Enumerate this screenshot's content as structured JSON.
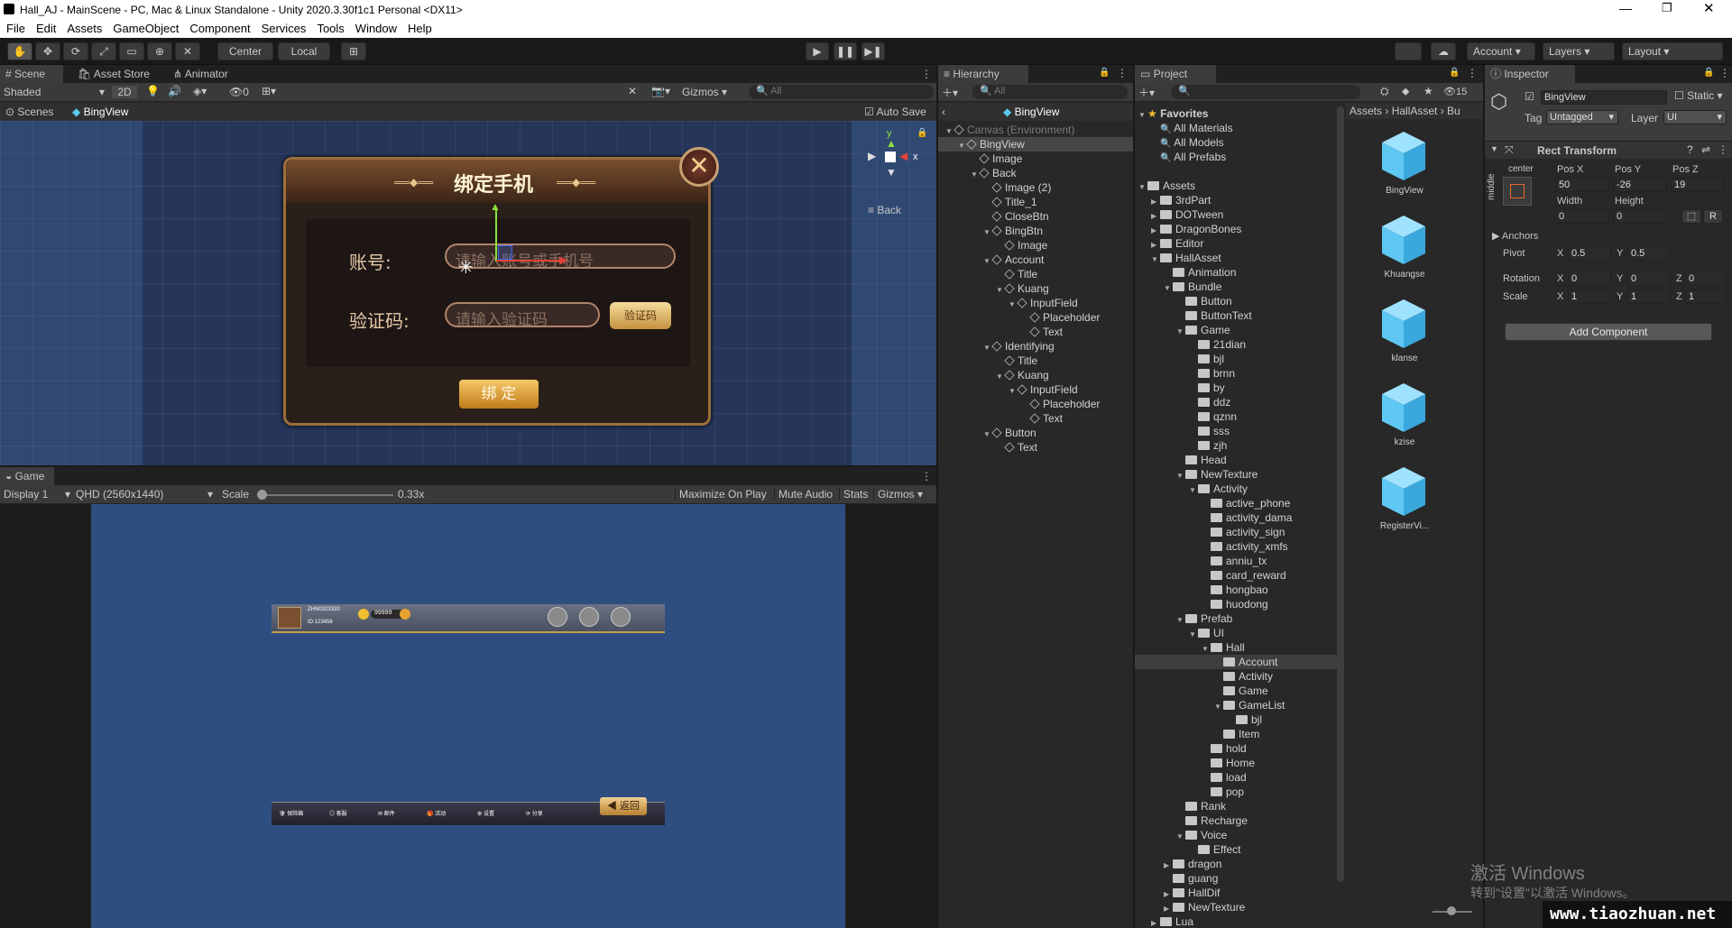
{
  "window": {
    "title": "Hall_AJ - MainScene - PC, Mac & Linux Standalone - Unity 2020.3.30f1c1 Personal <DX11>"
  },
  "menu": [
    "File",
    "Edit",
    "Assets",
    "GameObject",
    "Component",
    "Services",
    "Tools",
    "Window",
    "Help"
  ],
  "toolbar": {
    "center": "Center",
    "local": "Local",
    "account": "Account",
    "layers": "Layers",
    "layout": "Layout"
  },
  "scene": {
    "tabs": [
      "Scene",
      "Asset Store",
      "Animator"
    ],
    "shading": "Shaded",
    "mode2d": "2D",
    "hidden_count": "0",
    "gizmos": "Gizmos",
    "search_placeholder": "All",
    "breadcrumb_scenes": "Scenes",
    "breadcrumb_object": "BingView",
    "autosave": "Auto Save",
    "gizmo_y": "y",
    "gizmo_x": "x",
    "back_label": "Back",
    "dialog": {
      "title": "绑定手机",
      "account_label": "账号:",
      "account_placeholder": "请输入账号或手机号",
      "code_label": "验证码:",
      "code_placeholder": "请输入验证码",
      "code_button": "验证码",
      "bind_button": "绑 定"
    }
  },
  "game": {
    "tab": "Game",
    "display": "Display 1",
    "resolution": "QHD (2560x1440)",
    "scale_label": "Scale",
    "scale_value": "0.33x",
    "scale_fraction": 0.0,
    "buttons": [
      "Maximize On Play",
      "Mute Audio",
      "Stats",
      "Gizmos"
    ],
    "topbar": {
      "name": "ZHN0323333",
      "id": "ID:123456",
      "coins": "99999"
    },
    "bottombar": {
      "items": [
        "保险箱",
        "客服",
        "邮件",
        "活动",
        "设置",
        "分享"
      ],
      "back": "返回"
    }
  },
  "hierarchy": {
    "tab": "Hierarchy",
    "search_placeholder": "All",
    "header": "BingView",
    "rows": [
      {
        "label": "Canvas (Environment)",
        "depth": 0,
        "arrow": "▼",
        "dim": true
      },
      {
        "label": "BingView",
        "depth": 1,
        "arrow": "▼",
        "selected": true
      },
      {
        "label": "Image",
        "depth": 2,
        "arrow": ""
      },
      {
        "label": "Back",
        "depth": 2,
        "arrow": "▼"
      },
      {
        "label": "Image (2)",
        "depth": 3,
        "arrow": ""
      },
      {
        "label": "Title_1",
        "depth": 3,
        "arrow": ""
      },
      {
        "label": "CloseBtn",
        "depth": 3,
        "arrow": ""
      },
      {
        "label": "BingBtn",
        "depth": 3,
        "arrow": "▼"
      },
      {
        "label": "Image",
        "depth": 4,
        "arrow": ""
      },
      {
        "label": "Account",
        "depth": 3,
        "arrow": "▼"
      },
      {
        "label": "Title",
        "depth": 4,
        "arrow": ""
      },
      {
        "label": "Kuang",
        "depth": 4,
        "arrow": "▼"
      },
      {
        "label": "InputField",
        "depth": 5,
        "arrow": "▼"
      },
      {
        "label": "Placeholder",
        "depth": 6,
        "arrow": ""
      },
      {
        "label": "Text",
        "depth": 6,
        "arrow": ""
      },
      {
        "label": "Identifying",
        "depth": 3,
        "arrow": "▼"
      },
      {
        "label": "Title",
        "depth": 4,
        "arrow": ""
      },
      {
        "label": "Kuang",
        "depth": 4,
        "arrow": "▼"
      },
      {
        "label": "InputField",
        "depth": 5,
        "arrow": "▼"
      },
      {
        "label": "Placeholder",
        "depth": 6,
        "arrow": ""
      },
      {
        "label": "Text",
        "depth": 6,
        "arrow": ""
      },
      {
        "label": "Button",
        "depth": 3,
        "arrow": "▼"
      },
      {
        "label": "Text",
        "depth": 4,
        "arrow": ""
      }
    ]
  },
  "project": {
    "tab": "Project",
    "hidden_count": "15",
    "breadcrumb": [
      "Assets",
      "HallAsset",
      "Bu"
    ],
    "rows": [
      {
        "label": "Favorites",
        "depth": 0,
        "arrow": "▼",
        "type": "star"
      },
      {
        "label": "All Materials",
        "depth": 1,
        "arrow": "",
        "type": "search"
      },
      {
        "label": "All Models",
        "depth": 1,
        "arrow": "",
        "type": "search"
      },
      {
        "label": "All Prefabs",
        "depth": 1,
        "arrow": "",
        "type": "search"
      },
      {
        "label": "",
        "depth": 0,
        "arrow": "",
        "type": "blank"
      },
      {
        "label": "Assets",
        "depth": 0,
        "arrow": "▼",
        "type": "folder"
      },
      {
        "label": "3rdPart",
        "depth": 1,
        "arrow": "▶",
        "type": "folder"
      },
      {
        "label": "DOTween",
        "depth": 1,
        "arrow": "▶",
        "type": "folder"
      },
      {
        "label": "DragonBones",
        "depth": 1,
        "arrow": "▶",
        "type": "folder"
      },
      {
        "label": "Editor",
        "depth": 1,
        "arrow": "▶",
        "type": "folder"
      },
      {
        "label": "HallAsset",
        "depth": 1,
        "arrow": "▼",
        "type": "folder"
      },
      {
        "label": "Animation",
        "depth": 2,
        "arrow": "",
        "type": "folder"
      },
      {
        "label": "Bundle",
        "depth": 2,
        "arrow": "▼",
        "type": "folder"
      },
      {
        "label": "Button",
        "depth": 3,
        "arrow": "",
        "type": "folder"
      },
      {
        "label": "ButtonText",
        "depth": 3,
        "arrow": "",
        "type": "folder"
      },
      {
        "label": "Game",
        "depth": 3,
        "arrow": "▼",
        "type": "folder"
      },
      {
        "label": "21dian",
        "depth": 4,
        "arrow": "",
        "type": "folder"
      },
      {
        "label": "bjl",
        "depth": 4,
        "arrow": "",
        "type": "folder"
      },
      {
        "label": "brnn",
        "depth": 4,
        "arrow": "",
        "type": "folder"
      },
      {
        "label": "by",
        "depth": 4,
        "arrow": "",
        "type": "folder"
      },
      {
        "label": "ddz",
        "depth": 4,
        "arrow": "",
        "type": "folder"
      },
      {
        "label": "qznn",
        "depth": 4,
        "arrow": "",
        "type": "folder"
      },
      {
        "label": "sss",
        "depth": 4,
        "arrow": "",
        "type": "folder"
      },
      {
        "label": "zjh",
        "depth": 4,
        "arrow": "",
        "type": "folder"
      },
      {
        "label": "Head",
        "depth": 3,
        "arrow": "",
        "type": "folder"
      },
      {
        "label": "NewTexture",
        "depth": 3,
        "arrow": "▼",
        "type": "folder"
      },
      {
        "label": "Activity",
        "depth": 4,
        "arrow": "▼",
        "type": "folder"
      },
      {
        "label": "active_phone",
        "depth": 5,
        "arrow": "",
        "type": "folder"
      },
      {
        "label": "activity_dama",
        "depth": 5,
        "arrow": "",
        "type": "folder"
      },
      {
        "label": "activity_sign",
        "depth": 5,
        "arrow": "",
        "type": "folder"
      },
      {
        "label": "activity_xmfs",
        "depth": 5,
        "arrow": "",
        "type": "folder"
      },
      {
        "label": "anniu_tx",
        "depth": 5,
        "arrow": "",
        "type": "folder"
      },
      {
        "label": "card_reward",
        "depth": 5,
        "arrow": "",
        "type": "folder"
      },
      {
        "label": "hongbao",
        "depth": 5,
        "arrow": "",
        "type": "folder"
      },
      {
        "label": "huodong",
        "depth": 5,
        "arrow": "",
        "type": "folder"
      },
      {
        "label": "Prefab",
        "depth": 3,
        "arrow": "▼",
        "type": "folder"
      },
      {
        "label": "UI",
        "depth": 4,
        "arrow": "▼",
        "type": "folder"
      },
      {
        "label": "Hall",
        "depth": 5,
        "arrow": "▼",
        "type": "folder"
      },
      {
        "label": "Account",
        "depth": 6,
        "arrow": "",
        "type": "folder",
        "selected": true
      },
      {
        "label": "Activity",
        "depth": 6,
        "arrow": "",
        "type": "folder"
      },
      {
        "label": "Game",
        "depth": 6,
        "arrow": "",
        "type": "folder"
      },
      {
        "label": "GameList",
        "depth": 6,
        "arrow": "▼",
        "type": "folder"
      },
      {
        "label": "bjl",
        "depth": 7,
        "arrow": "",
        "type": "folder"
      },
      {
        "label": "Item",
        "depth": 6,
        "arrow": "",
        "type": "folder"
      },
      {
        "label": "hold",
        "depth": 5,
        "arrow": "",
        "type": "folder"
      },
      {
        "label": "Home",
        "depth": 5,
        "arrow": "",
        "type": "folder"
      },
      {
        "label": "load",
        "depth": 5,
        "arrow": "",
        "type": "folder"
      },
      {
        "label": "pop",
        "depth": 5,
        "arrow": "",
        "type": "folder"
      },
      {
        "label": "Rank",
        "depth": 3,
        "arrow": "",
        "type": "folder"
      },
      {
        "label": "Recharge",
        "depth": 3,
        "arrow": "",
        "type": "folder"
      },
      {
        "label": "Voice",
        "depth": 3,
        "arrow": "▼",
        "type": "folder"
      },
      {
        "label": "Effect",
        "depth": 4,
        "arrow": "",
        "type": "folder"
      },
      {
        "label": "dragon",
        "depth": 2,
        "arrow": "▶",
        "type": "folder"
      },
      {
        "label": "guang",
        "depth": 2,
        "arrow": "",
        "type": "folder"
      },
      {
        "label": "HallDif",
        "depth": 2,
        "arrow": "▶",
        "type": "folder"
      },
      {
        "label": "NewTexture",
        "depth": 2,
        "arrow": "▶",
        "type": "folder"
      },
      {
        "label": "Lua",
        "depth": 1,
        "arrow": "▶",
        "type": "folder"
      }
    ],
    "assets": [
      "BingView",
      "Khuangse",
      "klanse",
      "kzise",
      "RegisterVi..."
    ]
  },
  "inspector": {
    "tab": "Inspector",
    "object_name": "BingView",
    "static_label": "Static",
    "tag_label": "Tag",
    "tag_value": "Untagged",
    "layer_label": "Layer",
    "layer_value": "UI",
    "component": "Rect Transform",
    "anchor_h": "center",
    "anchor_v": "middle",
    "posx_label": "Pos X",
    "posy_label": "Pos Y",
    "posz_label": "Pos Z",
    "posx": "50",
    "posy": "-26",
    "posz": "19",
    "width_label": "Width",
    "height_label": "Height",
    "width": "0",
    "height": "0",
    "anchors_label": "Anchors",
    "pivot_label": "Pivot",
    "pivot_x": "0.5",
    "pivot_y": "0.5",
    "rotation_label": "Rotation",
    "rot_x": "0",
    "rot_y": "0",
    "rot_z": "0",
    "scale_label": "Scale",
    "scale_x": "1",
    "scale_y": "1",
    "scale_z": "1",
    "add_component": "Add Component",
    "axis_x": "X",
    "axis_y": "Y",
    "axis_z": "Z",
    "r_btn": "R"
  },
  "watermark": {
    "line1": "激活 Windows",
    "line2": "转到\"设置\"以激活 Windows。",
    "site": "www.tiaozhuan.net"
  }
}
